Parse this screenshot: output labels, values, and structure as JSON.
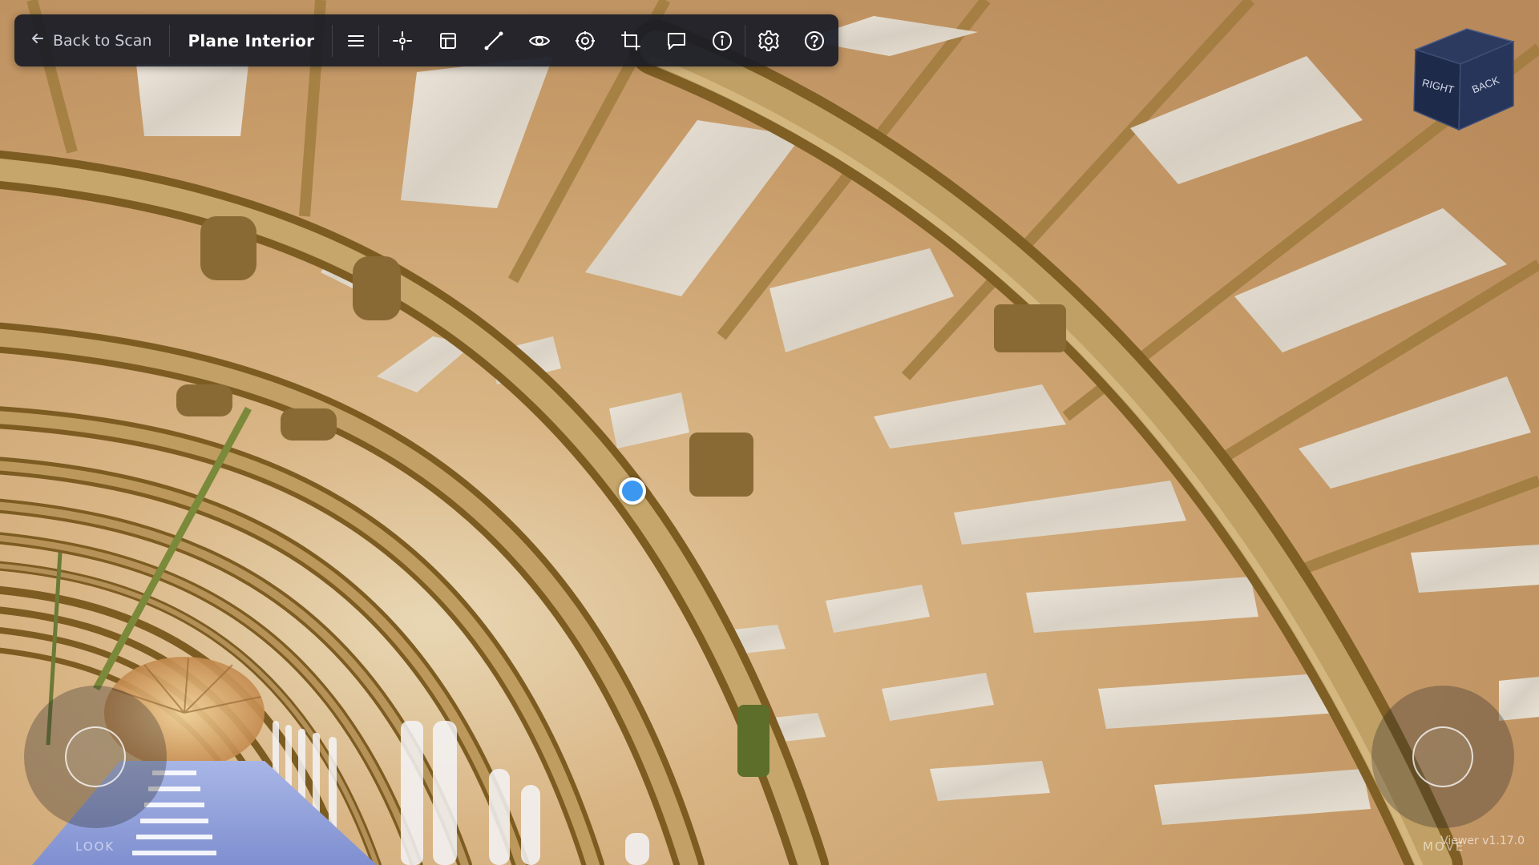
{
  "toolbar": {
    "back_label": "Back to Scan",
    "title": "Plane Interior",
    "icons": [
      "menu-icon",
      "crosshair-icon",
      "layout-icon",
      "measure-icon",
      "eye-icon",
      "target-icon",
      "crop-icon",
      "comment-icon",
      "info-icon",
      "settings-icon",
      "help-icon"
    ]
  },
  "navcube": {
    "face_right": "RIGHT",
    "face_back": "BACK"
  },
  "joysticks": {
    "look_label": "LOOK",
    "move_label": "MOVE"
  },
  "version": "Viewer v1.17.0",
  "colors": {
    "toolbar_bg": "#181b26",
    "hotspot": "#3b97f0",
    "cube": "#1e2a4a"
  }
}
